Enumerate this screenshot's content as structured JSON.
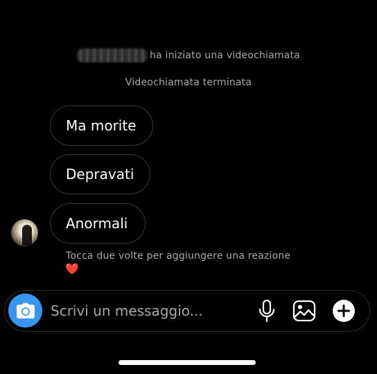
{
  "thread": {
    "call_started_text": "ha iniziato una videochiamata",
    "call_ended_text": "Videochiamata terminata",
    "messages": [
      {
        "text": "Ma morite"
      },
      {
        "text": "Depravati"
      },
      {
        "text": "Anormali"
      }
    ],
    "reaction_hint": "Tocca due volte per aggiungere una reazione",
    "reaction_emoji": "❤️"
  },
  "composer": {
    "placeholder": "Scrivi un messaggio...",
    "value": "",
    "camera_icon": "camera-icon",
    "mic_icon": "microphone-icon",
    "gallery_icon": "image-icon",
    "plus_icon": "plus-circle-icon"
  },
  "colors": {
    "background": "#000000",
    "bubble_border": "#3a3a3a",
    "secondary_text": "#a8a8a8",
    "accent_blue": "#3797f0",
    "heart_red": "#e8202f"
  }
}
